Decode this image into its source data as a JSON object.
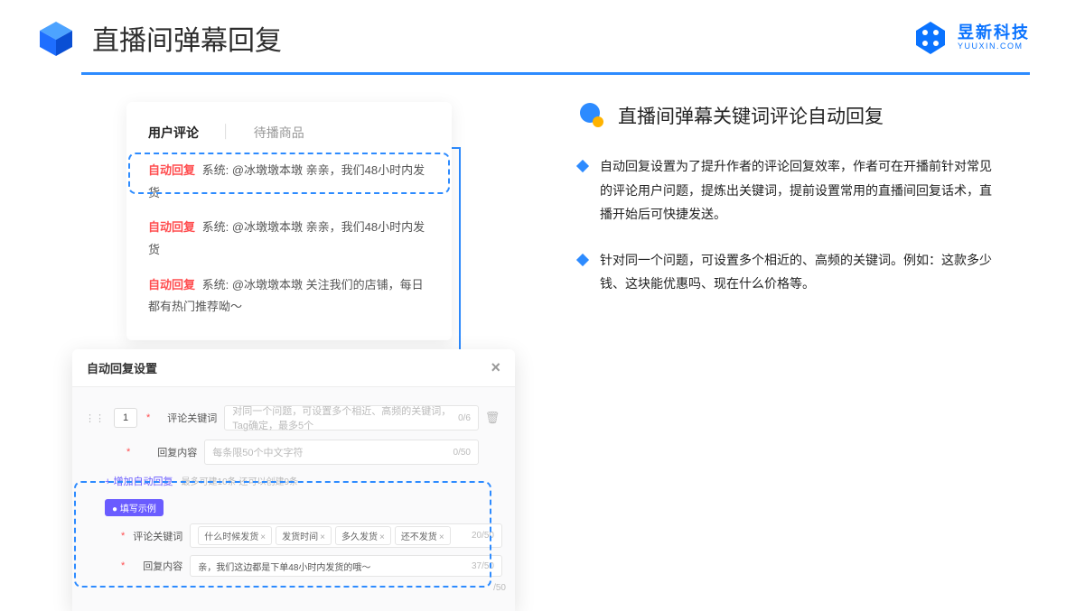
{
  "header": {
    "title": "直播间弹幕回复",
    "brand_cn": "昱新科技",
    "brand_en": "YUUXIN.COM"
  },
  "comments": {
    "tab_active": "用户评论",
    "tab_inactive": "待播商品",
    "rows": [
      {
        "tag": "自动回复",
        "text": "系统: @冰墩墩本墩 亲亲，我们48小时内发货"
      },
      {
        "tag": "自动回复",
        "text": "系统: @冰墩墩本墩 亲亲，我们48小时内发货"
      },
      {
        "tag": "自动回复",
        "text": "系统: @冰墩墩本墩 关注我们的店铺，每日都有热门推荐呦～"
      }
    ]
  },
  "settings": {
    "title": "自动回复设置",
    "close": "×",
    "index": "1",
    "label_keyword": "评论关键词",
    "placeholder_keyword": "对同一个问题，可设置多个相近、高频的关键词，Tag确定，最多5个",
    "counter_keyword": "0/6",
    "label_content": "回复内容",
    "placeholder_content": "每条限50个中文字符",
    "counter_content": "0/50",
    "add_link": "+ 增加自动回复",
    "add_hint": "最多可建10条 还可以创建9条",
    "example_badge": "● 填写示例",
    "ex_label_keyword": "评论关键词",
    "ex_tags": [
      "什么时候发货",
      "发货时间",
      "多久发货",
      "还不发货"
    ],
    "ex_kw_counter": "20/50",
    "ex_label_content": "回复内容",
    "ex_content": "亲，我们这边都是下单48小时内发货的哦～",
    "ex_content_counter": "37/50",
    "pagination": "/50"
  },
  "right": {
    "section_title": "直播间弹幕关键词评论自动回复",
    "bullets": [
      "自动回复设置为了提升作者的评论回复效率，作者可在开播前针对常见的评论用户问题，提炼出关键词，提前设置常用的直播间回复话术，直播开始后可快捷发送。",
      "针对同一个问题，可设置多个相近的、高频的关键词。例如：这款多少钱、这块能优惠吗、现在什么价格等。"
    ]
  }
}
